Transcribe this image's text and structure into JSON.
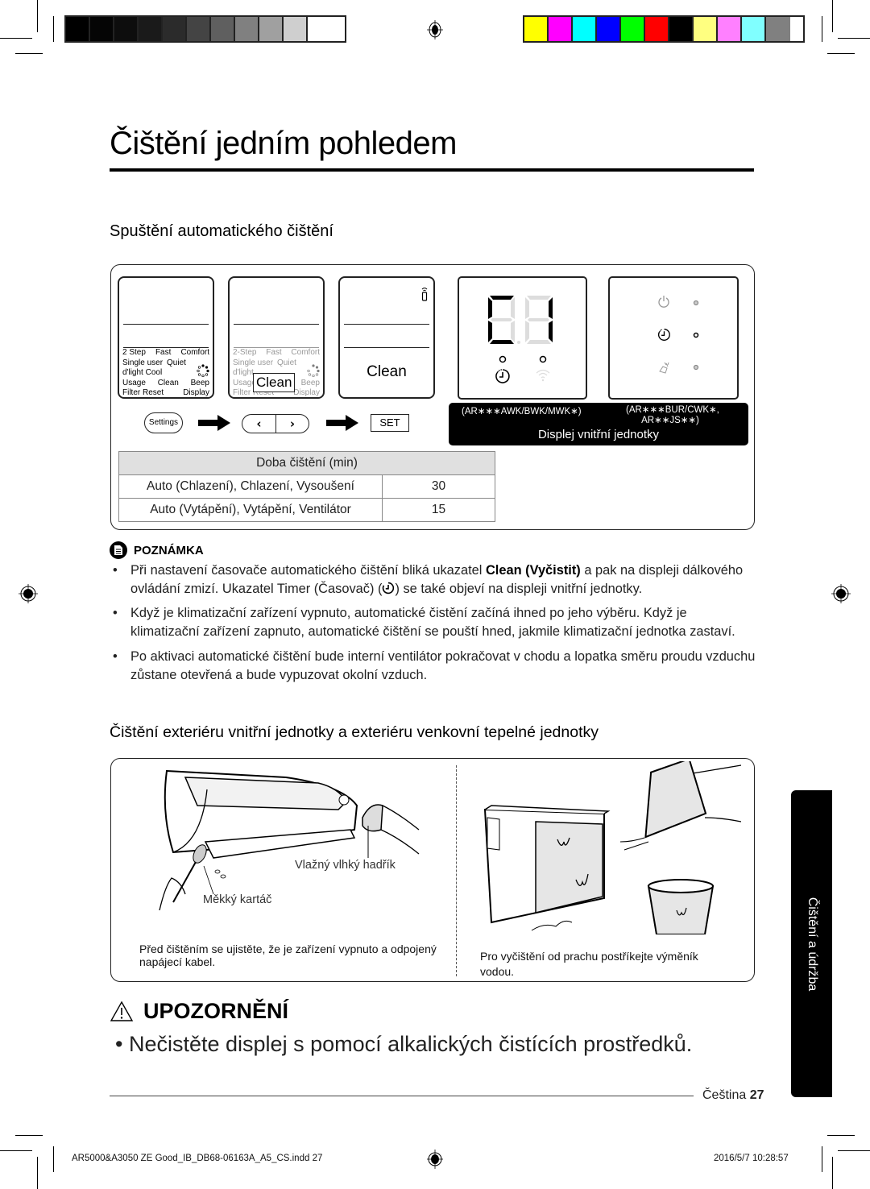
{
  "print_marks": {
    "grayscale_bar": [
      "#000000",
      "#050505",
      "#0d0d0d",
      "#1a1a1a",
      "#2b2b2b",
      "#444444",
      "#5f5f5f",
      "#808080",
      "#a0a0a0",
      "#cfcfcf",
      "#ffffff"
    ],
    "color_bar": [
      "#ffff00",
      "#ff00ff",
      "#00ffff",
      "#0000ff",
      "#00ff00",
      "#ff0000",
      "#000000",
      "#ffff80",
      "#ff80ff",
      "#80ffff",
      "#808080"
    ]
  },
  "page": {
    "title": "Čištění jedním pohledem",
    "section_title": "Spuštění automatického čištění"
  },
  "remote_steps": {
    "screen1_options": [
      [
        "2 Step",
        "Fast",
        "Comfort"
      ],
      [
        "Single user",
        "Quiet"
      ],
      [
        "d'light Cool"
      ],
      [
        "Usage",
        "Clean",
        "Beep"
      ],
      [
        "Filter Reset",
        "Display"
      ]
    ],
    "screen2_options": [
      [
        "2-Step",
        "Fast",
        "Comfort"
      ],
      [
        "Single user",
        "Quiet"
      ],
      [
        "d'light"
      ],
      [
        "Usage",
        "",
        "Beep"
      ],
      [
        "Filter Reset",
        "Display"
      ]
    ],
    "screen2_highlight": "Clean",
    "screen3_label": "Clean",
    "settings_button": "Settings",
    "prev_icon": "‹",
    "next_icon": "›",
    "set_button": "SET"
  },
  "indoor_display": {
    "segment_readout": "C1",
    "model_group_1": "(AR∗∗∗AWK/BWK/MWK∗)",
    "model_group_2_line1": "(AR∗∗∗BUR/CWK∗,",
    "model_group_2_line2": "AR∗∗JS∗∗)",
    "caption": "Displej vnitřní jednotky"
  },
  "cleaning_time_table": {
    "header": "Doba čištění (min)",
    "rows": [
      {
        "mode": "Auto (Chlazení), Chlazení, Vysoušení",
        "minutes": "30"
      },
      {
        "mode": "Auto (Vytápění), Vytápění, Ventilátor",
        "minutes": "15"
      }
    ]
  },
  "note": {
    "heading": "POZNÁMKA",
    "bullet1_a": "Při nastavení časovače automatického čištění bliká ukazatel ",
    "bullet1_bold": "Clean (Vyčistit)",
    "bullet1_b": " a pak na displeji dálkového ovládání zmizí. Ukazatel Timer (Časovač) (",
    "bullet1_c": ") se také objeví na displeji vnitřní jednotky.",
    "bullet2": "Když je klimatizační zařízení vypnuto, automatické čistění začíná ihned po jeho výběru. Když je klimatizační zařízení zapnuto, automatické čištění se pouští hned, jakmile klimatizační jednotka zastaví.",
    "bullet3": "Po aktivaci automatické čištění bude interní ventilátor pokračovat v chodu a lopatka směru proudu vzduchu zůstane otevřená a bude vypuzovat okolní vzduch."
  },
  "exterior": {
    "title": "Čištění exteriéru vnitřní jednotky a exteriéru venkovní tepelné jednotky",
    "label_cloth": "Vlažný vlhký hadřík",
    "label_brush": "Měkký kartáč",
    "caption_left": "Před čištěním se ujistěte, že je zařízení vypnuto a odpojený napájecí kabel.",
    "caption_right": "Pro vyčištění od prachu postříkejte výměník vodou."
  },
  "warning": {
    "heading": "UPOZORNĚNÍ",
    "text": "Nečistěte displej s pomocí alkalických čistících prostředků."
  },
  "side_tab": "Čištění a údržba",
  "footer": {
    "language": "Čeština",
    "page_number": "27",
    "file_slug": "AR5000&A3050 ZE Good_IB_DB68-06163A_A5_CS.indd   27",
    "timestamp": "2016/5/7   10:28:57"
  }
}
